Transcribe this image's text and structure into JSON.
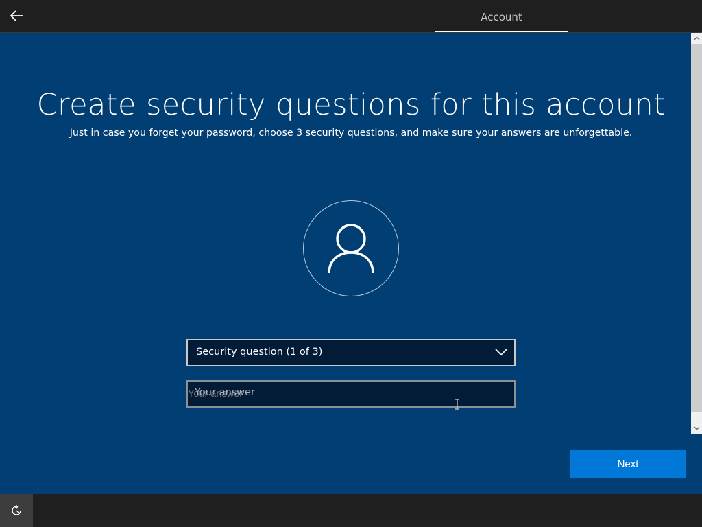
{
  "header": {
    "tab_label": "Account"
  },
  "page": {
    "title": "Create security questions for this account",
    "subtitle": "Just in case you forget your password, choose 3 security questions, and make sure your answers are unforgettable."
  },
  "form": {
    "question_select_value": "Security question (1 of 3)",
    "answer_placeholder": "Your answer"
  },
  "actions": {
    "next_label": "Next"
  },
  "icons": {
    "back": "back-arrow-icon",
    "avatar": "user-icon",
    "chevron": "chevron-down-icon",
    "accessibility": "ease-of-access-icon"
  },
  "colors": {
    "background": "#003e73",
    "topbar": "#1f1f1f",
    "accent": "#0078d7",
    "input_bg": "#021b36"
  }
}
